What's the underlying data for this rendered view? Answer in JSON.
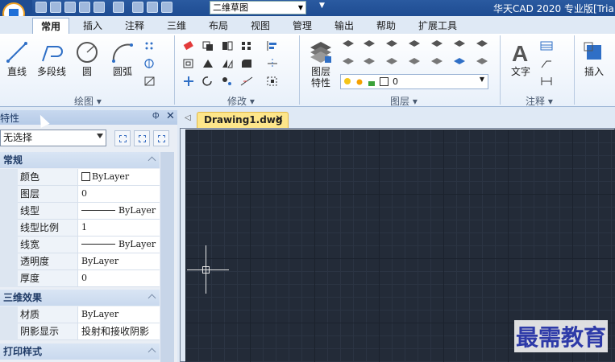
{
  "titlebar": {
    "workspace": "二维草图",
    "title": "华天CAD 2020 专业版[Trial"
  },
  "tabs": [
    {
      "label": "常用",
      "active": true
    },
    {
      "label": "插入"
    },
    {
      "label": "注释"
    },
    {
      "label": "三维"
    },
    {
      "label": "布局"
    },
    {
      "label": "视图"
    },
    {
      "label": "管理"
    },
    {
      "label": "输出"
    },
    {
      "label": "帮助"
    },
    {
      "label": "扩展工具"
    }
  ],
  "ribbon": {
    "draw": {
      "panel_label": "绘图 ▾",
      "line": "直线",
      "polyline": "多段线",
      "circle": "圆",
      "arc": "圆弧"
    },
    "modify": {
      "panel_label": "修改 ▾"
    },
    "layers": {
      "panel_label": "图层 ▾",
      "layer_props_line1": "图层",
      "layer_props_line2": "特性",
      "current_layer": "0"
    },
    "annotation": {
      "panel_label": "注释 ▾",
      "text": "文字"
    },
    "insert": {
      "label": "插入"
    }
  },
  "properties": {
    "title": "特性",
    "selection": "无选择",
    "categories": {
      "general": "常规",
      "3d": "三维效果",
      "print": "打印样式"
    },
    "general_rows": [
      {
        "name": "颜色",
        "value": "ByLayer"
      },
      {
        "name": "图层",
        "value": "0"
      },
      {
        "name": "线型",
        "value": "ByLayer"
      },
      {
        "name": "线型比例",
        "value": "1"
      },
      {
        "name": "线宽",
        "value": "ByLayer"
      },
      {
        "name": "透明度",
        "value": "ByLayer"
      },
      {
        "name": "厚度",
        "value": "0"
      }
    ],
    "3d_rows": [
      {
        "name": "材质",
        "value": "ByLayer"
      },
      {
        "name": "阴影显示",
        "value": "投射和接收阴影"
      }
    ]
  },
  "document": {
    "tab_label": "Drawing1.dwg"
  },
  "watermark": "最需教育",
  "colors": {
    "title_bar": "#1e4c92",
    "canvas_bg": "#232b38",
    "doc_tab": "#fde68a"
  }
}
